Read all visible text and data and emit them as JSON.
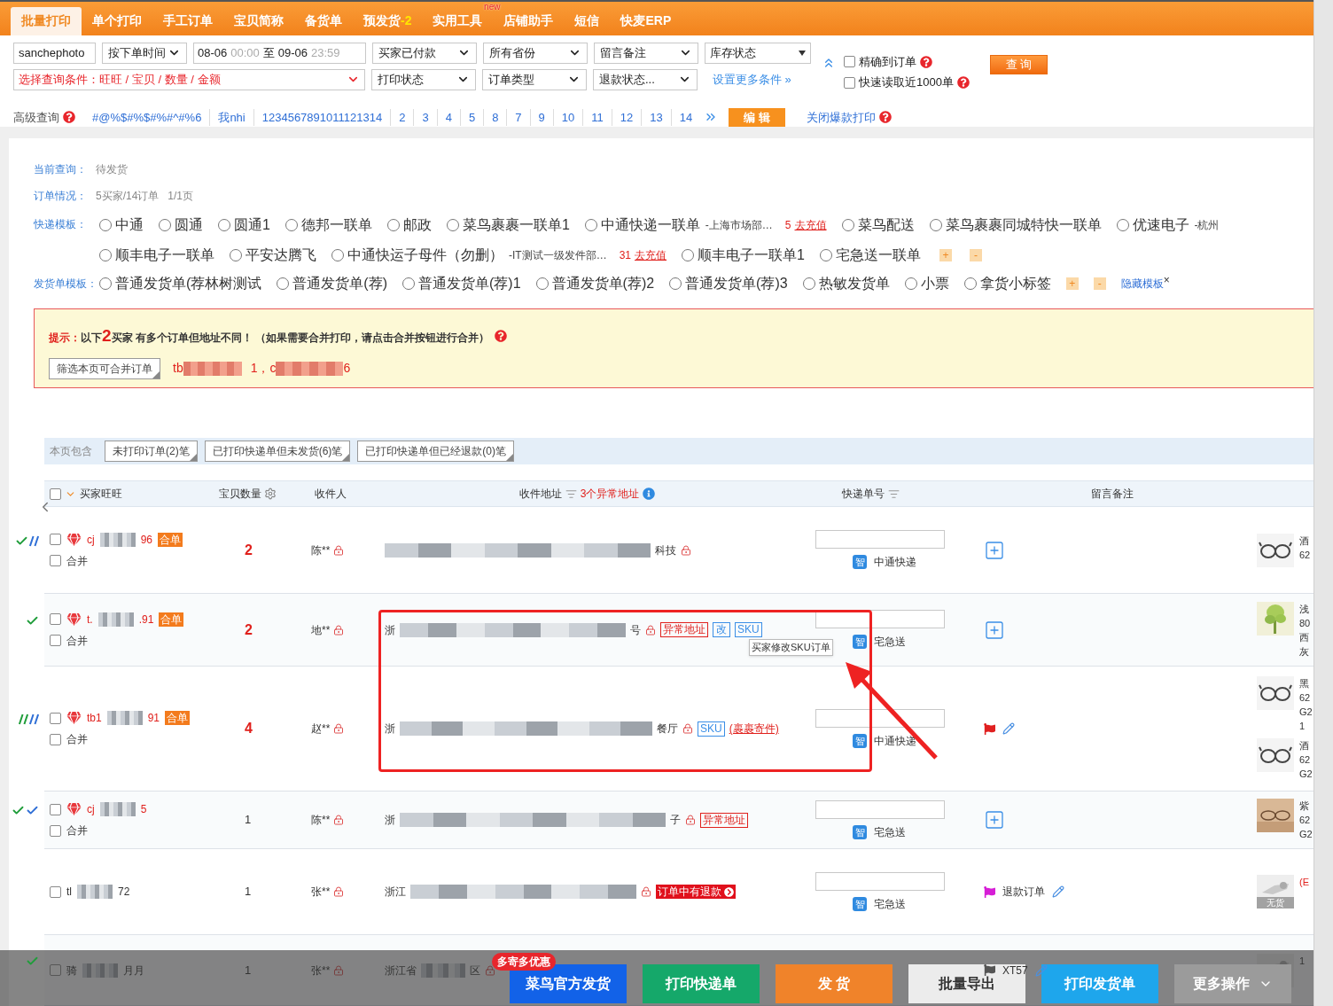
{
  "nav": {
    "tabs": [
      {
        "label": "批量打印",
        "selected": true
      },
      {
        "label": "单个打印",
        "selected": false
      },
      {
        "label": "手工订单",
        "selected": false
      },
      {
        "label": "宝贝简称",
        "selected": false
      },
      {
        "label": "备货单",
        "selected": false
      },
      {
        "label": "预发货",
        "count": "-2",
        "selected": false
      },
      {
        "label": "实用工具",
        "tag": "new",
        "selected": false
      },
      {
        "label": "店铺助手",
        "selected": false
      },
      {
        "label": "短信",
        "selected": false
      },
      {
        "label": "快麦ERP",
        "selected": false
      }
    ]
  },
  "filters": {
    "shop": "sanchephoto",
    "time_type": "按下单时间",
    "date_from": "08-06",
    "time_from": "00:00",
    "date_sep": "至",
    "date_to": "09-06",
    "time_to": "23:59",
    "selects_row1": [
      "买家已付款",
      "所有省份",
      "留言备注"
    ],
    "stock_select": "库存状态",
    "condition": "选择查询条件：旺旺 / 宝贝 / 数量 / 金额",
    "selects_row2": [
      "打印状态",
      "订单类型",
      "退款状态..."
    ],
    "more_link": "设置更多条件 »",
    "options": [
      {
        "label": "精确到订单",
        "checked": false
      },
      {
        "label": "快速读取近1000单",
        "checked": false
      }
    ],
    "query_button": "查 询"
  },
  "advanced": {
    "label": "高级查询",
    "saved": [
      "#@%$#%$#%#^#%6",
      "我nhi",
      "1234567891011121314",
      "2",
      "3",
      "4",
      "5",
      "8",
      "7",
      "9",
      "10",
      "11",
      "12",
      "13",
      "14"
    ],
    "edit_button": "编 辑",
    "close_link": "关闭爆款打印"
  },
  "summary": {
    "current_label": "当前查询：",
    "current_value": "待发货",
    "orders_label": "订单情况：",
    "orders_value": "5买家/14订单",
    "pages": "1/1页"
  },
  "express_templates": {
    "label": "快递模板：",
    "lines": [
      [
        {
          "name": "中通",
          "selected": false
        },
        {
          "name": "圆通",
          "selected": false
        },
        {
          "name": "圆通1",
          "selected": false
        },
        {
          "name": "德邦一联单",
          "selected": false
        },
        {
          "name": "邮政",
          "selected": false
        },
        {
          "name": "菜鸟裹裹一联单1",
          "selected": false
        },
        {
          "name": "中通快递一联单",
          "note": "-上海市场部…",
          "balance": "5",
          "recharge": "去充值",
          "selected": false
        },
        {
          "name": "菜鸟配送",
          "selected": false
        },
        {
          "name": "菜鸟裹裹同城特快一联单",
          "selected": false
        },
        {
          "name": "优速电子",
          "note": "-杭州",
          "selected": false
        }
      ],
      [
        {
          "name": "顺丰电子一联单",
          "selected": false
        },
        {
          "name": "平安达腾飞",
          "selected": false
        },
        {
          "name": "中通快运子母件（勿删）",
          "note": "-IT测试一级发件部…",
          "balance": "31",
          "recharge": "去充值",
          "selected": false
        },
        {
          "name": "顺丰电子一联单1",
          "selected": false
        },
        {
          "name": "宅急送一联单",
          "selected": false
        }
      ]
    ],
    "add": "+",
    "remove": "-"
  },
  "ship_templates": {
    "label": "发货单模板：",
    "items": [
      {
        "name": "普通发货单(荐林树测试",
        "selected": false
      },
      {
        "name": "普通发货单(荐)",
        "selected": false
      },
      {
        "name": "普通发货单(荐)1",
        "selected": false
      },
      {
        "name": "普通发货单(荐)2",
        "selected": false
      },
      {
        "name": "普通发货单(荐)3",
        "selected": false
      },
      {
        "name": "热敏发货单",
        "selected": false
      },
      {
        "name": "小票",
        "selected": false
      },
      {
        "name": "拿货小标签",
        "selected": false
      }
    ],
    "add": "+",
    "remove": "-",
    "hide_link": "隐藏模板",
    "close": "×"
  },
  "notice": {
    "label": "提示：",
    "prefix": "以下",
    "count": "2",
    "text": "买家 有多个订单但地址不同！ （如果需要合并打印，请点击合并按钮进行合并）",
    "filter_button": "筛选本页可合并订单",
    "buyer_a": "tb",
    "buyer_b": "1，c",
    "buyer_c": "6"
  },
  "page_filter": {
    "label": "本页包含",
    "buttons": [
      "未打印订单(2)笔",
      "已打印快递单但未发货(6)笔",
      "已打印快递单但已经退款(0)笔"
    ]
  },
  "table": {
    "select_all_checked": false,
    "columns": [
      "买家旺旺",
      "宝贝数量",
      "收件人",
      "收件地址",
      "快递单号",
      "留言备注"
    ],
    "abnormal_count": "3个异常地址",
    "rows": [
      {
        "marks": [
          {
            "kind": "check",
            "color": "#1f9d3a"
          },
          {
            "kind": "slash",
            "color": "#2f6fd6"
          }
        ],
        "checked": false,
        "vip": true,
        "buyer_start": "cj",
        "buyer_end": "96",
        "merged_tag": "合单",
        "merge_label": "合并",
        "merge_checked": false,
        "qty": "2",
        "qty_highlight": true,
        "recipient": "陈**",
        "addr_end": "科技",
        "tags": [],
        "smart": "智",
        "carrier": "中通快递",
        "note": {
          "kind": "add"
        },
        "products": [
          {
            "lines": [
              "酒",
              "62"
            ]
          }
        ]
      },
      {
        "marks": [
          {
            "kind": "check",
            "color": "#1f9d3a"
          }
        ],
        "checked": false,
        "vip": true,
        "buyer_start": "t.",
        "buyer_end": ".91",
        "merged_tag": "合单",
        "merge_label": "合并",
        "merge_checked": false,
        "qty": "2",
        "qty_highlight": true,
        "recipient": "地**",
        "addr_start": "浙",
        "addr_end": "号",
        "tags": [
          {
            "kind": "abnormal",
            "label": "异常地址"
          },
          {
            "kind": "edit",
            "label": "改"
          },
          {
            "kind": "sku",
            "label": "SKU"
          }
        ],
        "smart": "智",
        "carrier": "宅急送",
        "note": {
          "kind": "add"
        },
        "products": [
          {
            "lines": [
              "浅",
              "80",
              "西",
              "灰"
            ]
          }
        ]
      },
      {
        "marks": [
          {
            "kind": "slash",
            "color": "#1f9d3a"
          },
          {
            "kind": "slash",
            "color": "#2f6fd6"
          }
        ],
        "checked": false,
        "vip": true,
        "buyer_start": "tb1",
        "buyer_end": "91",
        "merged_tag": "合单",
        "merge_label": "合并",
        "merge_checked": false,
        "qty": "4",
        "qty_highlight": true,
        "recipient": "赵**",
        "addr_start": "浙",
        "addr_end": "餐厅",
        "tags": [
          {
            "kind": "sku",
            "label": "SKU"
          },
          {
            "kind": "link",
            "label": "(裹裹寄件)"
          }
        ],
        "smart": "智",
        "carrier": "中通快递",
        "note": {
          "kind": "flag",
          "color": "#e02020"
        },
        "products": [
          {
            "lines": [
              "黑",
              "62",
              "G2",
              "1"
            ]
          },
          {
            "lines": [
              "酒",
              "62",
              "G2"
            ]
          }
        ]
      },
      {
        "marks": [
          {
            "kind": "check",
            "color": "#1f9d3a"
          },
          {
            "kind": "check",
            "color": "#2f6fd6"
          }
        ],
        "checked": false,
        "vip": true,
        "buyer_start": "cj",
        "buyer_end": "5",
        "merge_label": "合并",
        "merge_checked": false,
        "qty": "1",
        "qty_highlight": false,
        "recipient": "陈**",
        "addr_start": "浙",
        "addr_end": "子",
        "tags": [
          {
            "kind": "abnormal",
            "label": "异常地址"
          }
        ],
        "smart": "智",
        "carrier": "宅急送",
        "note": {
          "kind": "add"
        },
        "products": [
          {
            "lines": [
              "紫",
              "62",
              "G2"
            ]
          }
        ]
      },
      {
        "marks": [],
        "checked": false,
        "vip": false,
        "buyer_start": "tl",
        "buyer_end": "72",
        "qty": "1",
        "qty_highlight": false,
        "recipient": "张**",
        "addr_start": "浙江",
        "tags": [
          {
            "kind": "refund",
            "label": "订单中有退款"
          }
        ],
        "smart": "智",
        "carrier": "宅急送",
        "note": {
          "kind": "flag",
          "color": "#d61ed6",
          "text": "退款订单"
        },
        "products": [
          {
            "lines": [
              "(E"
            ],
            "stock": "无货"
          }
        ]
      },
      {
        "marks": [
          {
            "kind": "check",
            "color": "#1f9d3a"
          }
        ],
        "checked": false,
        "vip": false,
        "buyer_start": "骑",
        "buyer_end": "月月",
        "qty": "1",
        "qty_highlight": false,
        "recipient": "张**",
        "addr_start": "浙江省",
        "addr_end": "区",
        "tags": [],
        "note": {
          "kind": "flag",
          "color": "#555555",
          "text": "XT57"
        },
        "products": [
          {
            "lines": [
              "1"
            ]
          }
        ]
      }
    ]
  },
  "tooltip": "买家修改SKU订单",
  "bottom_bar": {
    "promo": "多寄多优惠",
    "buttons": [
      {
        "label": "菜鸟官方发货",
        "kind": "solid",
        "color": "#1262e8"
      },
      {
        "label": "打印快递单",
        "kind": "solid",
        "color": "#15a86a"
      },
      {
        "label": "发 货",
        "kind": "solid",
        "color": "#f0832a"
      },
      {
        "label": "批量导出",
        "kind": "light",
        "color": "#ececec"
      },
      {
        "label": "打印发货单",
        "kind": "solid",
        "color": "#1ea6ec"
      },
      {
        "label": "更多操作",
        "kind": "menu",
        "color": "#9b9b9b"
      }
    ]
  }
}
